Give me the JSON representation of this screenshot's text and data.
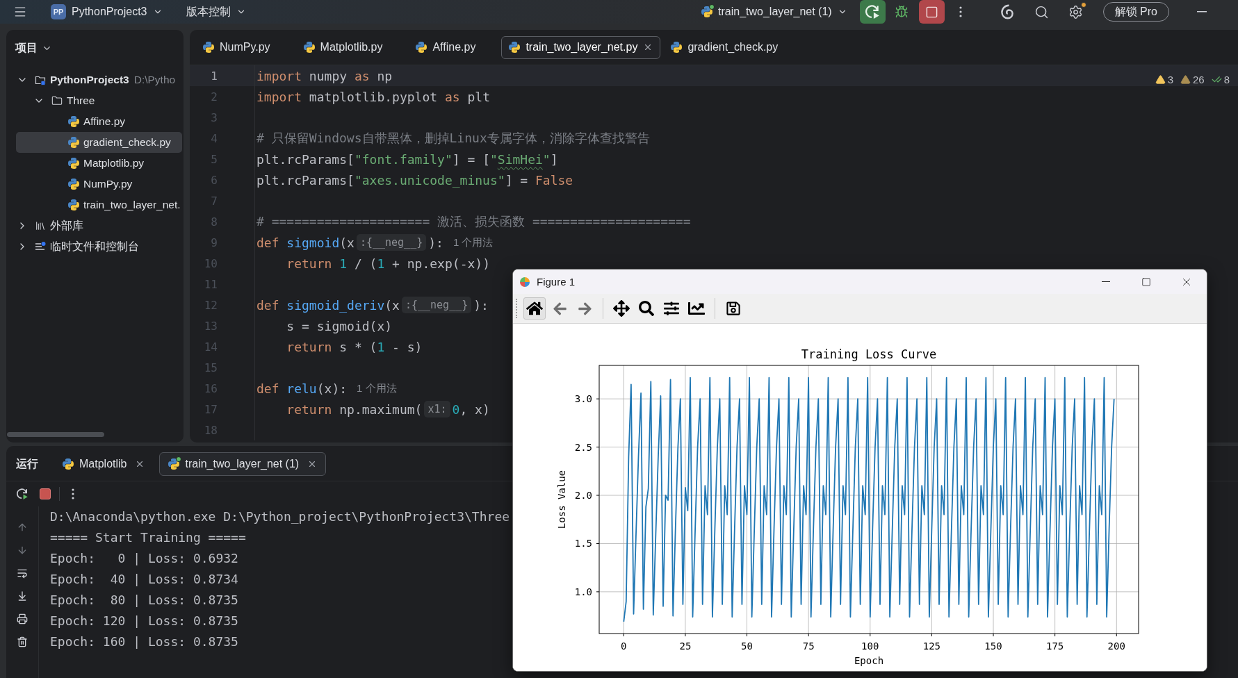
{
  "top_bar": {
    "project_badge": "PP",
    "project": "PythonProject3",
    "vcs": "版本控制",
    "run_config": {
      "label": "train_two_layer_net (1)",
      "running": true
    },
    "unlock": "解锁 Pro"
  },
  "project_panel": {
    "title": "项目",
    "tree": [
      {
        "label": "PythonProject3",
        "kind": "project",
        "path": "D:\\Pytho",
        "expanded": true,
        "selected": false,
        "children": [
          {
            "label": "Three",
            "kind": "folder",
            "expanded": true,
            "selected": false,
            "children": [
              {
                "label": "Affine.py",
                "kind": "file",
                "selected": false
              },
              {
                "label": "gradient_check.py",
                "kind": "file",
                "selected": true
              },
              {
                "label": "Matplotlib.py",
                "kind": "file",
                "selected": false
              },
              {
                "label": "NumPy.py",
                "kind": "file",
                "selected": false
              },
              {
                "label": "train_two_layer_net.",
                "kind": "file",
                "selected": false
              }
            ]
          }
        ]
      },
      {
        "label": "外部库",
        "kind": "library",
        "expanded": false,
        "selected": false
      },
      {
        "label": "临时文件和控制台",
        "kind": "scratches",
        "expanded": false,
        "selected": false
      }
    ]
  },
  "editor": {
    "tabs": [
      {
        "label": "NumPy.py",
        "selected": false
      },
      {
        "label": "Matplotlib.py",
        "selected": false
      },
      {
        "label": "Affine.py",
        "selected": false
      },
      {
        "label": "train_two_layer_net.py",
        "selected": true
      },
      {
        "label": "gradient_check.py",
        "selected": false
      }
    ],
    "inspections": [
      {
        "kind": "warning",
        "count": "3"
      },
      {
        "kind": "weak_warning",
        "count": "26"
      },
      {
        "kind": "typo",
        "count": "8"
      }
    ],
    "lines": [
      {
        "number": "1",
        "current": true,
        "tokens": [
          {
            "kind": "keyword",
            "text": "import"
          },
          {
            "kind": "plain",
            "text": " numpy "
          },
          {
            "kind": "keyword",
            "text": "as"
          },
          {
            "kind": "plain",
            "text": " np"
          }
        ]
      },
      {
        "number": "2",
        "current": false,
        "tokens": [
          {
            "kind": "keyword",
            "text": "import"
          },
          {
            "kind": "plain",
            "text": " matplotlib.pyplot "
          },
          {
            "kind": "keyword",
            "text": "as"
          },
          {
            "kind": "plain",
            "text": " plt"
          }
        ]
      },
      {
        "number": "3",
        "current": false
      },
      {
        "number": "4",
        "current": false,
        "tokens": [
          {
            "kind": "comment",
            "text": "# 只保留Windows自带黑体，删掉Linux专属字体，消除字体查找警告"
          }
        ]
      },
      {
        "number": "5",
        "current": false,
        "tokens": [
          {
            "kind": "plain",
            "text": "plt.rcParams["
          },
          {
            "kind": "string",
            "text": "\"font.family\""
          },
          {
            "kind": "plain",
            "text": "] = ["
          },
          {
            "kind": "string",
            "text": "\""
          },
          {
            "kind": "typo",
            "text": "SimHei"
          },
          {
            "kind": "string",
            "text": "\""
          },
          {
            "kind": "plain",
            "text": "]"
          }
        ]
      },
      {
        "number": "6",
        "current": false,
        "tokens": [
          {
            "kind": "plain",
            "text": "plt.rcParams["
          },
          {
            "kind": "string",
            "text": "\"axes.unicode_minus\""
          },
          {
            "kind": "plain",
            "text": "] = "
          },
          {
            "kind": "keyword",
            "text": "False"
          }
        ]
      },
      {
        "number": "7",
        "current": false
      },
      {
        "number": "8",
        "current": false,
        "tokens": [
          {
            "kind": "comment",
            "text": "# ===================== 激活、损失函数 ====================="
          }
        ]
      },
      {
        "number": "9",
        "current": false,
        "tokens": [
          {
            "kind": "keyword",
            "text": "def "
          },
          {
            "kind": "function",
            "text": "sigmoid"
          },
          {
            "kind": "plain",
            "text": "(x"
          },
          {
            "kind": "hint",
            "text": ":{__neg__}"
          },
          {
            "kind": "plain",
            "text": "):"
          },
          {
            "kind": "usage",
            "text": "1 个用法"
          }
        ]
      },
      {
        "number": "10",
        "current": false,
        "tokens": [
          {
            "kind": "keyword",
            "text": "    return "
          },
          {
            "kind": "number",
            "text": "1"
          },
          {
            "kind": "plain",
            "text": " / ("
          },
          {
            "kind": "number",
            "text": "1"
          },
          {
            "kind": "plain",
            "text": " + np.exp(-x))"
          }
        ]
      },
      {
        "number": "11",
        "current": false
      },
      {
        "number": "12",
        "current": false,
        "tokens": [
          {
            "kind": "keyword",
            "text": "def "
          },
          {
            "kind": "function",
            "text": "sigmoid_deriv"
          },
          {
            "kind": "plain",
            "text": "(x"
          },
          {
            "kind": "hint",
            "text": ":{__neg__}"
          },
          {
            "kind": "plain",
            "text": "):"
          }
        ]
      },
      {
        "number": "13",
        "current": false,
        "tokens": [
          {
            "kind": "plain",
            "text": "    s = sigmoid(x)"
          }
        ]
      },
      {
        "number": "14",
        "current": false,
        "tokens": [
          {
            "kind": "keyword",
            "text": "    return"
          },
          {
            "kind": "plain",
            "text": " s * ("
          },
          {
            "kind": "number",
            "text": "1"
          },
          {
            "kind": "plain",
            "text": " - s)"
          }
        ]
      },
      {
        "number": "15",
        "current": false
      },
      {
        "number": "16",
        "current": false,
        "tokens": [
          {
            "kind": "keyword",
            "text": "def "
          },
          {
            "kind": "function",
            "text": "relu"
          },
          {
            "kind": "plain",
            "text": "(x):"
          },
          {
            "kind": "usage",
            "text": "1 个用法"
          }
        ]
      },
      {
        "number": "17",
        "current": false,
        "tokens": [
          {
            "kind": "keyword",
            "text": "    return"
          },
          {
            "kind": "plain",
            "text": " np.maximum("
          },
          {
            "kind": "hint",
            "text": "x1:"
          },
          {
            "kind": "number",
            "text": "0"
          },
          {
            "kind": "plain",
            "text": ", x)"
          }
        ]
      },
      {
        "number": "18",
        "current": false
      }
    ]
  },
  "run_panel": {
    "title": "运行",
    "tabs": [
      {
        "label": "Matplotlib",
        "selected": false,
        "running": false
      },
      {
        "label": "train_two_layer_net (1)",
        "selected": true,
        "running": true
      }
    ],
    "output": [
      "D:\\Anaconda\\python.exe D:\\Python_project\\PythonProject3\\Three",
      "===== Start Training =====",
      "Epoch:   0 | Loss: 0.6932",
      "Epoch:  40 | Loss: 0.8734",
      "Epoch:  80 | Loss: 0.8735",
      "Epoch: 120 | Loss: 0.8735",
      "Epoch: 160 | Loss: 0.8735"
    ]
  },
  "figure": {
    "title": "Figure 1",
    "toolbar": [
      {
        "kind": "home",
        "selected": true,
        "disabled": false
      },
      {
        "kind": "back",
        "selected": false,
        "disabled": true
      },
      {
        "kind": "forward",
        "selected": false,
        "disabled": true
      },
      {
        "kind": "pan",
        "selected": false,
        "disabled": false
      },
      {
        "kind": "zoom",
        "selected": false,
        "disabled": false
      },
      {
        "kind": "subplots",
        "selected": false,
        "disabled": false
      },
      {
        "kind": "edit_axes",
        "selected": false,
        "disabled": false
      },
      {
        "kind": "save",
        "selected": false,
        "disabled": false
      }
    ],
    "chart_data": {
      "type": "line",
      "title": "Training Loss Curve",
      "xlabel": "Epoch",
      "ylabel": "Loss Value",
      "grid": true,
      "xlim": [
        -9.95,
        208.95
      ],
      "ylim": [
        0.567,
        3.347
      ],
      "xticks": [
        0,
        25,
        50,
        75,
        100,
        125,
        150,
        175,
        200
      ],
      "yticks": [
        {
          "value": 1.0,
          "label": "1.0"
        },
        {
          "value": 1.5,
          "label": "1.5"
        },
        {
          "value": 2.0,
          "label": "2.0"
        },
        {
          "value": 2.5,
          "label": "2.5"
        },
        {
          "value": 3.0,
          "label": "3.0"
        }
      ],
      "x": [
        0,
        1,
        2,
        3,
        4,
        5,
        6,
        7,
        8,
        9,
        10,
        11,
        12,
        13,
        14,
        15,
        16,
        17,
        18,
        19,
        20,
        21,
        22,
        23,
        24,
        25,
        26,
        27,
        28,
        29,
        30,
        31,
        32,
        33,
        34,
        35,
        36,
        37,
        38,
        39,
        40,
        41,
        42,
        43,
        44,
        45,
        46,
        47,
        48,
        49,
        50,
        51,
        52,
        53,
        54,
        55,
        56,
        57,
        58,
        59,
        60,
        61,
        62,
        63,
        64,
        65,
        66,
        67,
        68,
        69,
        70,
        71,
        72,
        73,
        74,
        75,
        76,
        77,
        78,
        79,
        80,
        81,
        82,
        83,
        84,
        85,
        86,
        87,
        88,
        89,
        90,
        91,
        92,
        93,
        94,
        95,
        96,
        97,
        98,
        99,
        100,
        101,
        102,
        103,
        104,
        105,
        106,
        107,
        108,
        109,
        110,
        111,
        112,
        113,
        114,
        115,
        116,
        117,
        118,
        119,
        120,
        121,
        122,
        123,
        124,
        125,
        126,
        127,
        128,
        129,
        130,
        131,
        132,
        133,
        134,
        135,
        136,
        137,
        138,
        139,
        140,
        141,
        142,
        143,
        144,
        145,
        146,
        147,
        148,
        149,
        150,
        151,
        152,
        153,
        154,
        155,
        156,
        157,
        158,
        159,
        160,
        161,
        162,
        163,
        164,
        165,
        166,
        167,
        168,
        169,
        170,
        171,
        172,
        173,
        174,
        175,
        176,
        177,
        178,
        179,
        180,
        181,
        182,
        183,
        184,
        185,
        186,
        187,
        188,
        189,
        190,
        191,
        192,
        193,
        194,
        195,
        196,
        197,
        198,
        199
      ],
      "series": [
        {
          "color": "#1f77b4",
          "values": [
            0.69,
            0.9,
            2.4,
            3.15,
            0.77,
            1.6,
            2.4,
            3.06,
            0.82,
            1.88,
            2.07,
            3.18,
            0.76,
            1.6,
            2.4,
            3.03,
            0.85,
            2.0,
            1.95,
            3.2,
            0.75,
            1.65,
            2.5,
            3.0,
            0.87,
            2.08,
            1.84,
            3.22,
            0.74,
            1.65,
            2.5,
            3.0,
            0.87,
            2.1,
            1.8,
            3.22,
            0.74,
            1.65,
            2.5,
            3.0,
            0.87,
            2.1,
            1.8,
            3.22,
            0.74,
            1.65,
            2.5,
            3.0,
            0.87,
            2.1,
            1.8,
            3.22,
            0.74,
            1.65,
            2.5,
            3.0,
            0.87,
            2.1,
            1.8,
            3.22,
            0.74,
            1.65,
            2.5,
            3.0,
            0.87,
            2.1,
            1.8,
            3.22,
            0.74,
            1.65,
            2.5,
            3.0,
            0.87,
            2.1,
            1.8,
            3.22,
            0.74,
            1.65,
            2.5,
            3.0,
            0.87,
            2.1,
            1.8,
            3.22,
            0.74,
            1.65,
            2.5,
            3.0,
            0.87,
            2.1,
            1.8,
            3.22,
            0.74,
            1.65,
            2.5,
            3.0,
            0.87,
            2.1,
            1.8,
            3.22,
            0.74,
            1.65,
            2.5,
            3.0,
            0.87,
            2.1,
            1.8,
            3.22,
            0.74,
            1.65,
            2.5,
            3.0,
            0.87,
            2.1,
            1.8,
            3.22,
            0.74,
            1.65,
            2.5,
            3.0,
            0.87,
            2.1,
            1.8,
            3.22,
            0.74,
            1.65,
            2.5,
            3.0,
            0.87,
            2.1,
            1.8,
            3.22,
            0.74,
            1.65,
            2.5,
            3.0,
            0.87,
            2.1,
            1.8,
            3.22,
            0.74,
            1.65,
            2.5,
            3.0,
            0.87,
            2.1,
            1.8,
            3.22,
            0.74,
            1.65,
            2.5,
            3.0,
            0.87,
            2.1,
            1.8,
            3.22,
            0.74,
            1.65,
            2.5,
            3.0,
            0.87,
            2.1,
            1.8,
            3.22,
            0.74,
            1.65,
            2.5,
            3.0,
            0.87,
            2.1,
            1.8,
            3.22,
            0.74,
            1.65,
            2.5,
            3.0,
            0.87,
            2.1,
            1.8,
            3.22,
            0.74,
            1.65,
            2.5,
            3.0,
            0.87,
            2.1,
            1.8,
            3.22,
            0.74,
            1.65,
            2.5,
            3.0,
            0.87,
            2.1,
            1.8,
            3.22,
            0.74,
            1.65,
            2.5,
            3.0
          ]
        }
      ]
    }
  }
}
